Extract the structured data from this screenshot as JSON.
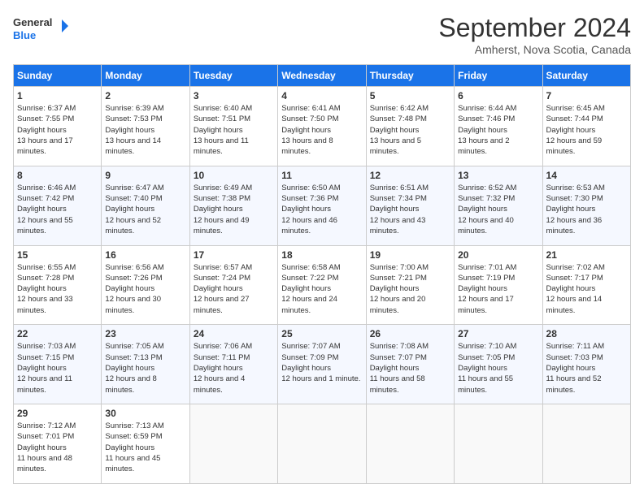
{
  "logo": {
    "line1": "General",
    "line2": "Blue"
  },
  "title": "September 2024",
  "location": "Amherst, Nova Scotia, Canada",
  "weekdays": [
    "Sunday",
    "Monday",
    "Tuesday",
    "Wednesday",
    "Thursday",
    "Friday",
    "Saturday"
  ],
  "weeks": [
    [
      {
        "day": "1",
        "sunrise": "6:37 AM",
        "sunset": "7:55 PM",
        "daylight": "13 hours and 17 minutes."
      },
      {
        "day": "2",
        "sunrise": "6:39 AM",
        "sunset": "7:53 PM",
        "daylight": "13 hours and 14 minutes."
      },
      {
        "day": "3",
        "sunrise": "6:40 AM",
        "sunset": "7:51 PM",
        "daylight": "13 hours and 11 minutes."
      },
      {
        "day": "4",
        "sunrise": "6:41 AM",
        "sunset": "7:50 PM",
        "daylight": "13 hours and 8 minutes."
      },
      {
        "day": "5",
        "sunrise": "6:42 AM",
        "sunset": "7:48 PM",
        "daylight": "13 hours and 5 minutes."
      },
      {
        "day": "6",
        "sunrise": "6:44 AM",
        "sunset": "7:46 PM",
        "daylight": "13 hours and 2 minutes."
      },
      {
        "day": "7",
        "sunrise": "6:45 AM",
        "sunset": "7:44 PM",
        "daylight": "12 hours and 59 minutes."
      }
    ],
    [
      {
        "day": "8",
        "sunrise": "6:46 AM",
        "sunset": "7:42 PM",
        "daylight": "12 hours and 55 minutes."
      },
      {
        "day": "9",
        "sunrise": "6:47 AM",
        "sunset": "7:40 PM",
        "daylight": "12 hours and 52 minutes."
      },
      {
        "day": "10",
        "sunrise": "6:49 AM",
        "sunset": "7:38 PM",
        "daylight": "12 hours and 49 minutes."
      },
      {
        "day": "11",
        "sunrise": "6:50 AM",
        "sunset": "7:36 PM",
        "daylight": "12 hours and 46 minutes."
      },
      {
        "day": "12",
        "sunrise": "6:51 AM",
        "sunset": "7:34 PM",
        "daylight": "12 hours and 43 minutes."
      },
      {
        "day": "13",
        "sunrise": "6:52 AM",
        "sunset": "7:32 PM",
        "daylight": "12 hours and 40 minutes."
      },
      {
        "day": "14",
        "sunrise": "6:53 AM",
        "sunset": "7:30 PM",
        "daylight": "12 hours and 36 minutes."
      }
    ],
    [
      {
        "day": "15",
        "sunrise": "6:55 AM",
        "sunset": "7:28 PM",
        "daylight": "12 hours and 33 minutes."
      },
      {
        "day": "16",
        "sunrise": "6:56 AM",
        "sunset": "7:26 PM",
        "daylight": "12 hours and 30 minutes."
      },
      {
        "day": "17",
        "sunrise": "6:57 AM",
        "sunset": "7:24 PM",
        "daylight": "12 hours and 27 minutes."
      },
      {
        "day": "18",
        "sunrise": "6:58 AM",
        "sunset": "7:22 PM",
        "daylight": "12 hours and 24 minutes."
      },
      {
        "day": "19",
        "sunrise": "7:00 AM",
        "sunset": "7:21 PM",
        "daylight": "12 hours and 20 minutes."
      },
      {
        "day": "20",
        "sunrise": "7:01 AM",
        "sunset": "7:19 PM",
        "daylight": "12 hours and 17 minutes."
      },
      {
        "day": "21",
        "sunrise": "7:02 AM",
        "sunset": "7:17 PM",
        "daylight": "12 hours and 14 minutes."
      }
    ],
    [
      {
        "day": "22",
        "sunrise": "7:03 AM",
        "sunset": "7:15 PM",
        "daylight": "12 hours and 11 minutes."
      },
      {
        "day": "23",
        "sunrise": "7:05 AM",
        "sunset": "7:13 PM",
        "daylight": "12 hours and 8 minutes."
      },
      {
        "day": "24",
        "sunrise": "7:06 AM",
        "sunset": "7:11 PM",
        "daylight": "12 hours and 4 minutes."
      },
      {
        "day": "25",
        "sunrise": "7:07 AM",
        "sunset": "7:09 PM",
        "daylight": "12 hours and 1 minute."
      },
      {
        "day": "26",
        "sunrise": "7:08 AM",
        "sunset": "7:07 PM",
        "daylight": "11 hours and 58 minutes."
      },
      {
        "day": "27",
        "sunrise": "7:10 AM",
        "sunset": "7:05 PM",
        "daylight": "11 hours and 55 minutes."
      },
      {
        "day": "28",
        "sunrise": "7:11 AM",
        "sunset": "7:03 PM",
        "daylight": "11 hours and 52 minutes."
      }
    ],
    [
      {
        "day": "29",
        "sunrise": "7:12 AM",
        "sunset": "7:01 PM",
        "daylight": "11 hours and 48 minutes."
      },
      {
        "day": "30",
        "sunrise": "7:13 AM",
        "sunset": "6:59 PM",
        "daylight": "11 hours and 45 minutes."
      },
      null,
      null,
      null,
      null,
      null
    ]
  ]
}
